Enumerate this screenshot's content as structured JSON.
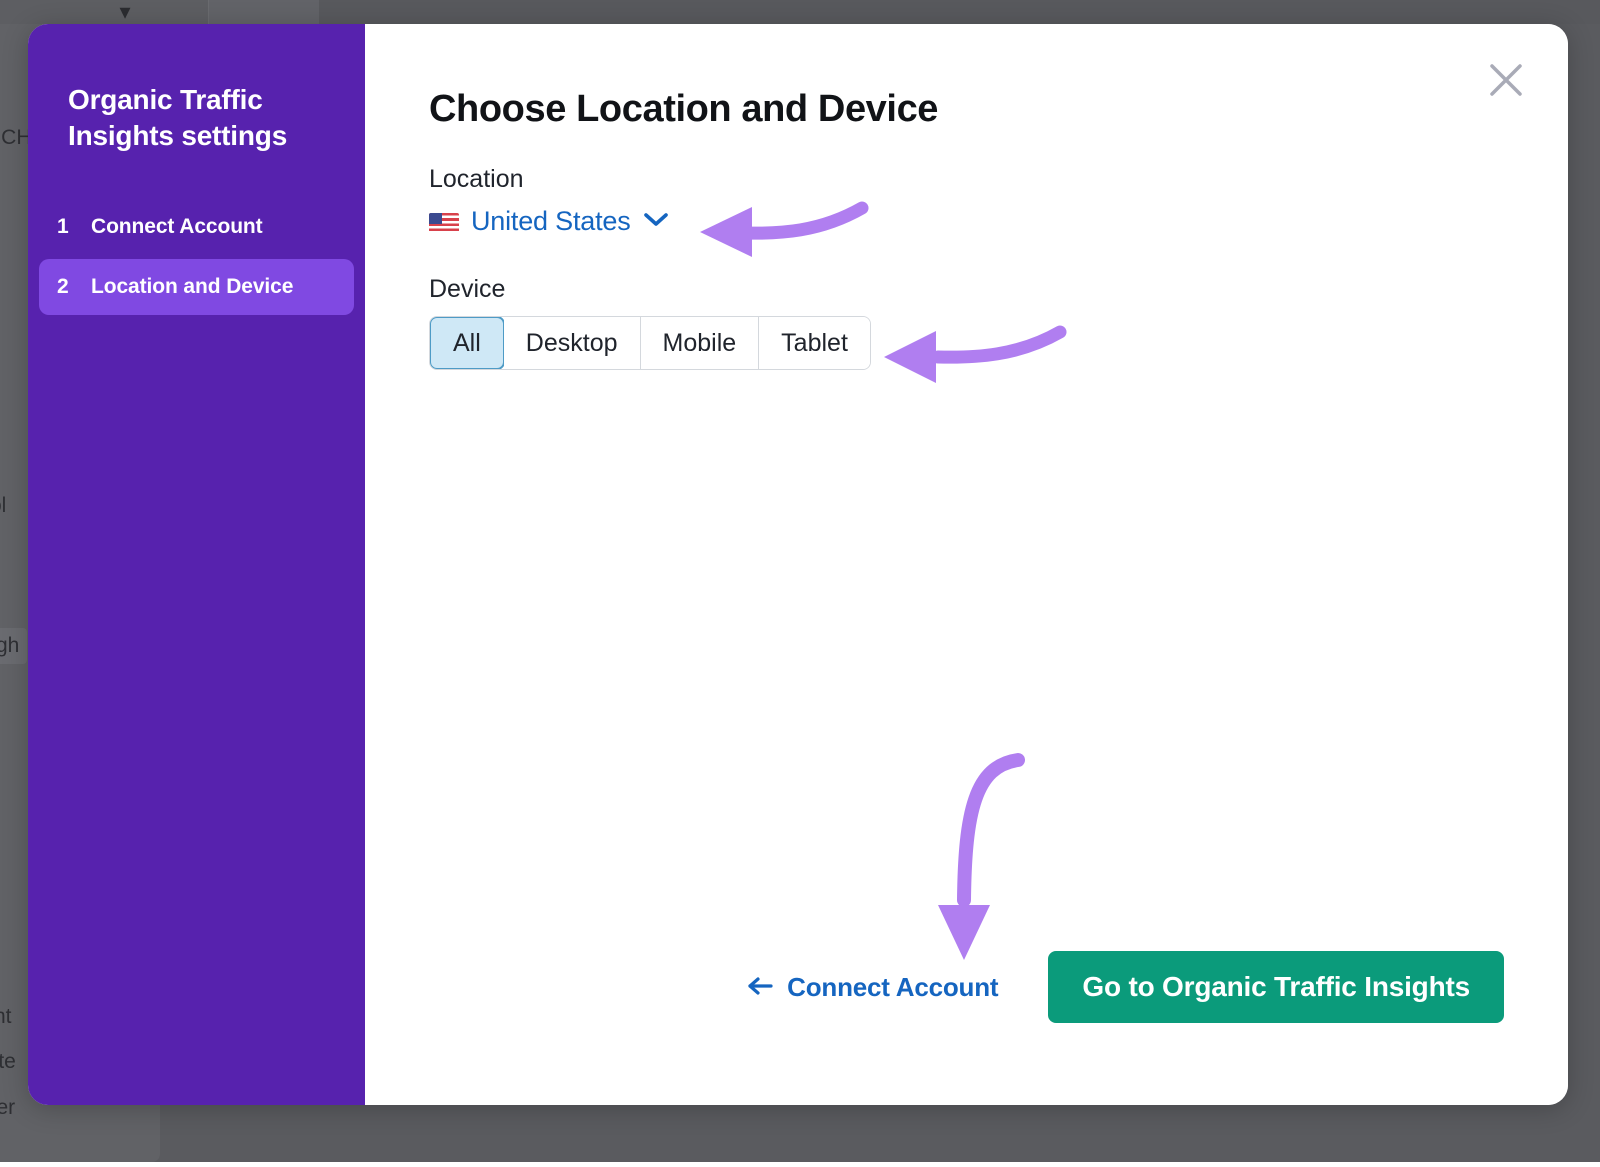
{
  "background": {
    "fragments": [
      "RCH",
      "ol",
      "gh",
      "nt",
      "late",
      "ker"
    ],
    "dim_color": "#5a5b5f"
  },
  "modal": {
    "close_icon": "close-icon",
    "sidebar": {
      "title": "Organic Traffic Insights settings",
      "steps": [
        {
          "number": "1",
          "label": "Connect Account",
          "active": false
        },
        {
          "number": "2",
          "label": "Location and Device",
          "active": true
        }
      ],
      "bg_color": "#5722ae",
      "active_color": "#8049e2"
    },
    "heading": "Choose Location and Device",
    "location": {
      "label": "Location",
      "flag_icon": "us-flag-icon",
      "value": "United States",
      "chevron_icon": "chevron-down-icon",
      "link_color": "#1565c0"
    },
    "device": {
      "label": "Device",
      "options": [
        "All",
        "Desktop",
        "Mobile",
        "Tablet"
      ],
      "selected": "All",
      "selected_bg": "#cfe8f6",
      "selected_border": "#4e9bc6"
    },
    "footer": {
      "back_icon": "arrow-left-icon",
      "back_label": "Connect Account",
      "primary_label": "Go to Organic Traffic Insights",
      "primary_color": "#0b9b7b"
    }
  },
  "annotations": {
    "color": "#b07ef0",
    "arrows": [
      {
        "name": "arrow-to-location-dropdown",
        "direction": "left"
      },
      {
        "name": "arrow-to-device-selector",
        "direction": "left"
      },
      {
        "name": "arrow-to-primary-button",
        "direction": "down"
      }
    ]
  }
}
